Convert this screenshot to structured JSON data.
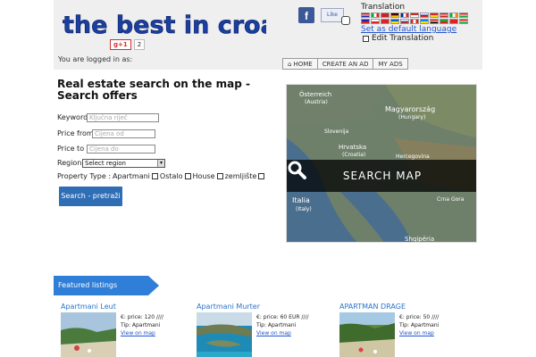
{
  "header": {
    "logo_text": "the best in croatia",
    "gplus_label": "g+1",
    "gplus_count": "2",
    "fb_label": "f",
    "fb_like": "Like",
    "translation_title": "Translation",
    "default_language": "Set as default language",
    "edit_translation": "Edit Translation",
    "logged_in": "You are logged in as:"
  },
  "nav": {
    "home": "HOME",
    "create_ad": "CREATE AN AD",
    "my_ads": "MY ADS"
  },
  "search": {
    "title": "Real estate search on the map - Search offers",
    "keyword_label": "Keyword",
    "keyword_placeholder": "Ključna riječ",
    "price_from_label": "Price from",
    "price_from_placeholder": "Cijena od",
    "price_to_label": "Price to",
    "price_to_placeholder": "Cijena do",
    "region_label": "Region",
    "region_value": "Select region",
    "property_type_label": "Property Type :",
    "types": [
      "Apartmani",
      "Ostalo",
      "House",
      "zemljište"
    ],
    "button": "Search - pretraži"
  },
  "map": {
    "label": "SEARCH MAP",
    "places": [
      "Österreich",
      "(Austria)",
      "Magyarország",
      "(Hungary)",
      "Slovenija",
      "Hrvatska",
      "(Croatia)",
      "Hercegovina",
      "Crna Gora",
      "Italia",
      "(Italy)",
      "Shqipëria"
    ]
  },
  "featured": {
    "label": "Featured listings",
    "listings": [
      {
        "title": "Apartmani Leut",
        "price": "€: price: 120 ////",
        "type": "Tip: Apartmani",
        "link": "View on map"
      },
      {
        "title": "Apartmani Murter",
        "price": "€: price: 60 EUR ////",
        "type": "Tip: Apartmani",
        "link": "View on map"
      },
      {
        "title": "APARTMAN DRAGE",
        "price": "€: price: 50 ////",
        "type": "Tip: Apartmani",
        "link": "View on map"
      }
    ]
  },
  "colors": {
    "accent": "#2f6db5",
    "link": "#2b73c6",
    "header_bg": "#efefef"
  }
}
